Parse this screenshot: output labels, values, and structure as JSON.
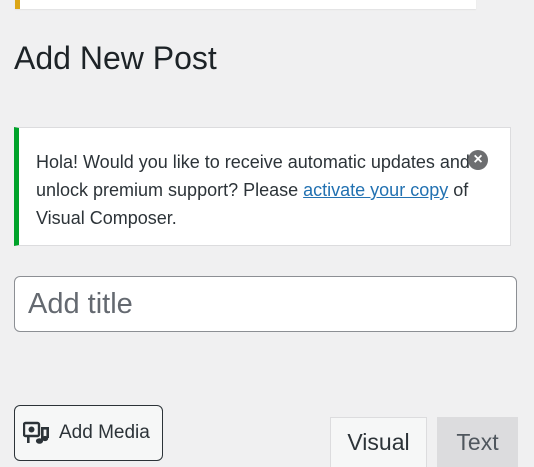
{
  "page": {
    "title": "Add New Post"
  },
  "notice": {
    "text_before": "Hola! Would you like to receive automatic updates and unlock premium support? Please ",
    "link_text": "activate your copy",
    "text_after": " of Visual Composer.",
    "dismiss_icon": "dismiss-circle-icon",
    "accent_color": "#00a32a"
  },
  "title_field": {
    "placeholder": "Add title",
    "value": ""
  },
  "media": {
    "button_label": "Add Media",
    "icon": "add-media-icon"
  },
  "editor_tabs": [
    {
      "label": "Visual",
      "active": true
    },
    {
      "label": "Text",
      "active": false
    }
  ],
  "colors": {
    "background": "#f0f0f1",
    "link": "#2271b1",
    "warning_accent": "#dba617"
  }
}
